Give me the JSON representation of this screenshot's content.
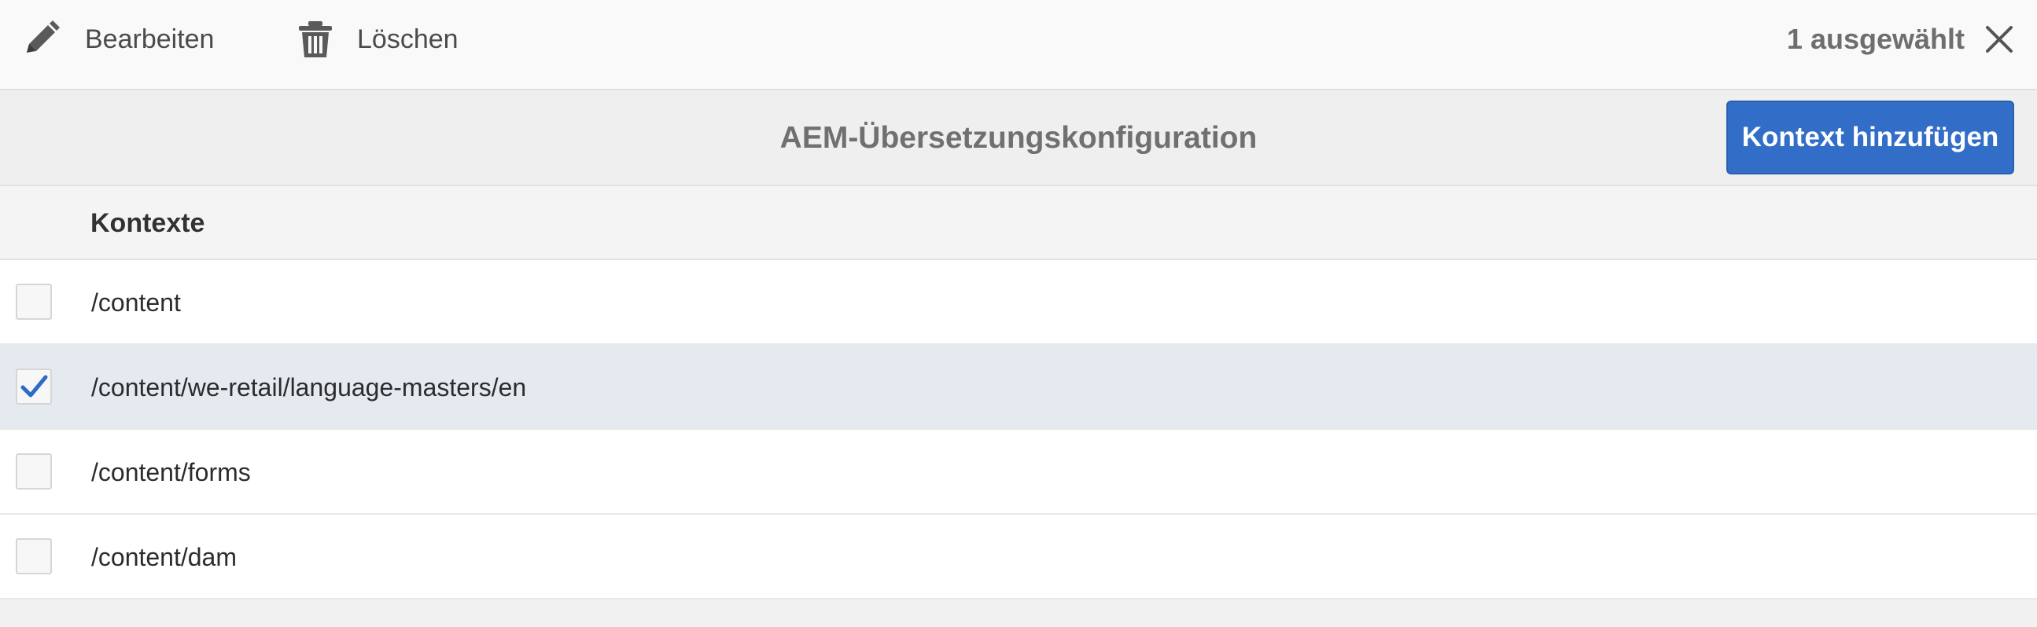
{
  "actionbar": {
    "edit_label": "Bearbeiten",
    "edit_icon": "pencil-icon",
    "delete_label": "Löschen",
    "delete_icon": "trash-icon",
    "selection_count": "1 ausgewählt",
    "close_icon": "close-icon"
  },
  "header": {
    "title": "AEM-Übersetzungskonfiguration",
    "add_button_label": "Kontext hinzufügen"
  },
  "table": {
    "column_header": "Kontexte",
    "rows": [
      {
        "path": "/content",
        "selected": false
      },
      {
        "path": "/content/we-retail/language-masters/en",
        "selected": true
      },
      {
        "path": "/content/forms",
        "selected": false
      },
      {
        "path": "/content/dam",
        "selected": false
      }
    ]
  },
  "colors": {
    "primary": "#326ec8",
    "selected_row": "#e5eaf1",
    "check": "#2f6ac8"
  }
}
